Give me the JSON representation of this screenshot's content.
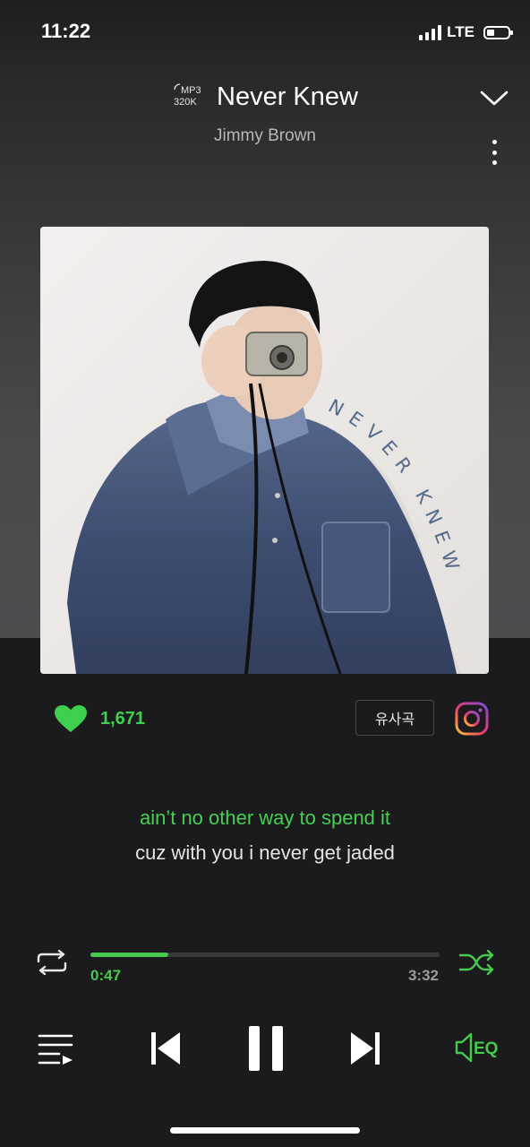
{
  "status_bar": {
    "time": "11:22",
    "network": "LTE",
    "battery_percent": 25
  },
  "header": {
    "format_line1": "MP3",
    "format_line2": "320K",
    "title": "Never Knew",
    "artist": "Jimmy Brown"
  },
  "album_art": {
    "text": "NEVER KNEW"
  },
  "actions": {
    "like_count": "1,671",
    "similar_label": "유사곡"
  },
  "lyrics": {
    "current": "ain’t no other way to spend it",
    "next": "cuz with you i never get jaded"
  },
  "progress": {
    "elapsed": "0:47",
    "total": "3:32",
    "fraction": 0.222
  },
  "controls": {
    "eq_label": "EQ"
  },
  "colors": {
    "accent": "#46c94e",
    "background": "#1b1b1d",
    "text_secondary": "#9b9b9b"
  }
}
